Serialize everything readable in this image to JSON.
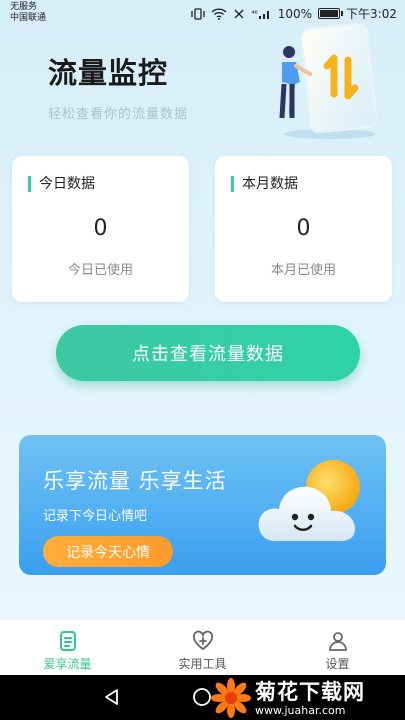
{
  "status_bar": {
    "carrier_line1": "无服务",
    "carrier_line2": "中国联通",
    "signal_text": "⁴⁶",
    "battery_percent": "100%",
    "time": "下午3:02",
    "battery_level": 1.0
  },
  "header": {
    "title": "流量监控",
    "subtitle": "轻松查看你的流量数据"
  },
  "cards": {
    "today": {
      "label": "今日数据",
      "value": "0",
      "caption": "今日已使用"
    },
    "month": {
      "label": "本月数据",
      "value": "0",
      "caption": "本月已使用"
    }
  },
  "main_button": {
    "label": "点击查看流量数据"
  },
  "banner": {
    "title": "乐享流量 乐享生活",
    "subtitle": "记录下今日心情吧",
    "button_label": "记录今天心情"
  },
  "bottom_nav": {
    "items": [
      {
        "label": "爱享流量",
        "icon": "document-icon",
        "active": true
      },
      {
        "label": "实用工具",
        "icon": "heart-plus-icon",
        "active": false
      },
      {
        "label": "设置",
        "icon": "user-icon",
        "active": false
      }
    ]
  },
  "watermark": {
    "title": "菊花下载网",
    "url": "www.juahar.com"
  },
  "colors": {
    "accent_green": "#2ed3a0",
    "banner_blue": "#3a9ff0",
    "orange": "#ff9a2a"
  }
}
